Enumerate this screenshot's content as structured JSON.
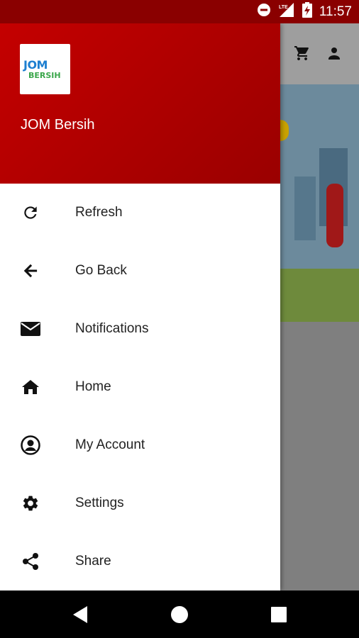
{
  "status_bar": {
    "time": "11:57",
    "icons": [
      "do-not-disturb-icon",
      "lte-signal-icon",
      "battery-charging-icon"
    ]
  },
  "drawer": {
    "app_name": "JOM Bersih",
    "logo_text_top": "JOM",
    "logo_text_bottom": "BERSIH",
    "header_color": "#b00000",
    "items": [
      {
        "label": "Refresh",
        "icon": "refresh-icon"
      },
      {
        "label": "Go Back",
        "icon": "arrow-left-icon"
      },
      {
        "label": "Notifications",
        "icon": "envelope-icon"
      },
      {
        "label": "Home",
        "icon": "home-icon"
      },
      {
        "label": "My Account",
        "icon": "user-circle-icon"
      },
      {
        "label": "Settings",
        "icon": "gear-icon"
      },
      {
        "label": "Share",
        "icon": "share-icon"
      }
    ]
  },
  "app_toolbar": {
    "icons": [
      "cart-icon",
      "person-icon"
    ]
  },
  "nav_bar": {
    "buttons": [
      "back-triangle-icon",
      "home-circle-icon",
      "recents-square-icon"
    ]
  }
}
